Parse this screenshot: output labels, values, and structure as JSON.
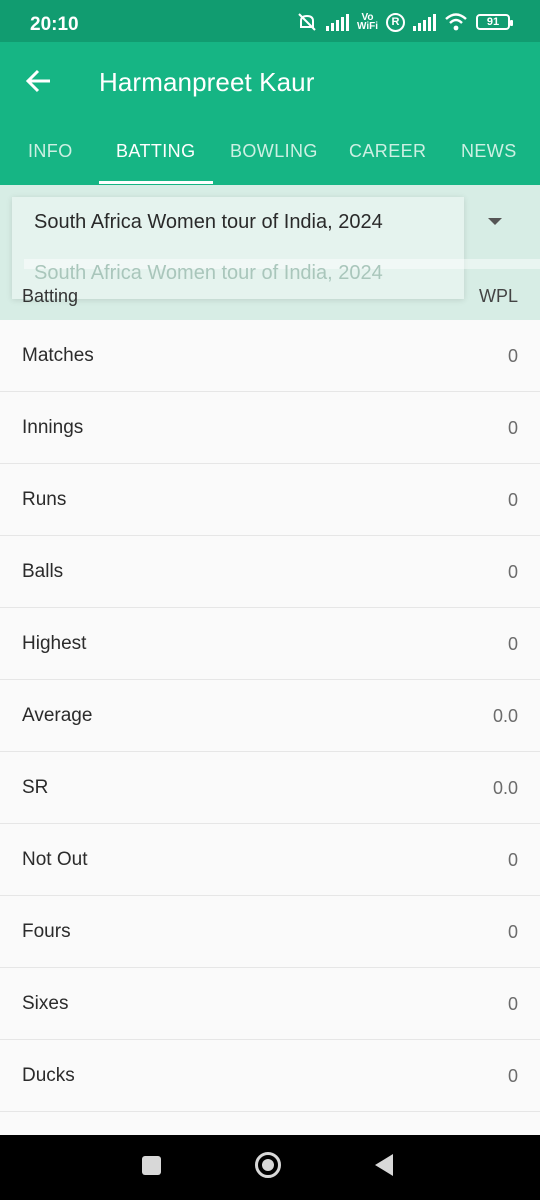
{
  "status_bar": {
    "time": "20:10",
    "vowifi_top": "Vo",
    "vowifi_bottom": "WiFi",
    "roaming": "R",
    "battery": "91"
  },
  "header": {
    "title": "Harmanpreet Kaur",
    "tabs": [
      {
        "label": "INFO",
        "active": false
      },
      {
        "label": "BATTING",
        "active": true
      },
      {
        "label": "BOWLING",
        "active": false
      },
      {
        "label": "CAREER",
        "active": false
      },
      {
        "label": "NEWS",
        "active": false
      }
    ]
  },
  "filter": {
    "selected": "South Africa Women tour of India, 2024",
    "option": "South Africa Women tour of India, 2024",
    "column_left": "Batting",
    "column_right": "WPL"
  },
  "stats": [
    {
      "label": "Matches",
      "value": "0"
    },
    {
      "label": "Innings",
      "value": "0"
    },
    {
      "label": "Runs",
      "value": "0"
    },
    {
      "label": "Balls",
      "value": "0"
    },
    {
      "label": "Highest",
      "value": "0"
    },
    {
      "label": "Average",
      "value": "0.0"
    },
    {
      "label": "SR",
      "value": "0.0"
    },
    {
      "label": "Not Out",
      "value": "0"
    },
    {
      "label": "Fours",
      "value": "0"
    },
    {
      "label": "Sixes",
      "value": "0"
    },
    {
      "label": "Ducks",
      "value": "0"
    }
  ],
  "colors": {
    "status_bar": "#119c70",
    "app_bar": "#16b584",
    "filter_bg": "#d7ede5"
  }
}
